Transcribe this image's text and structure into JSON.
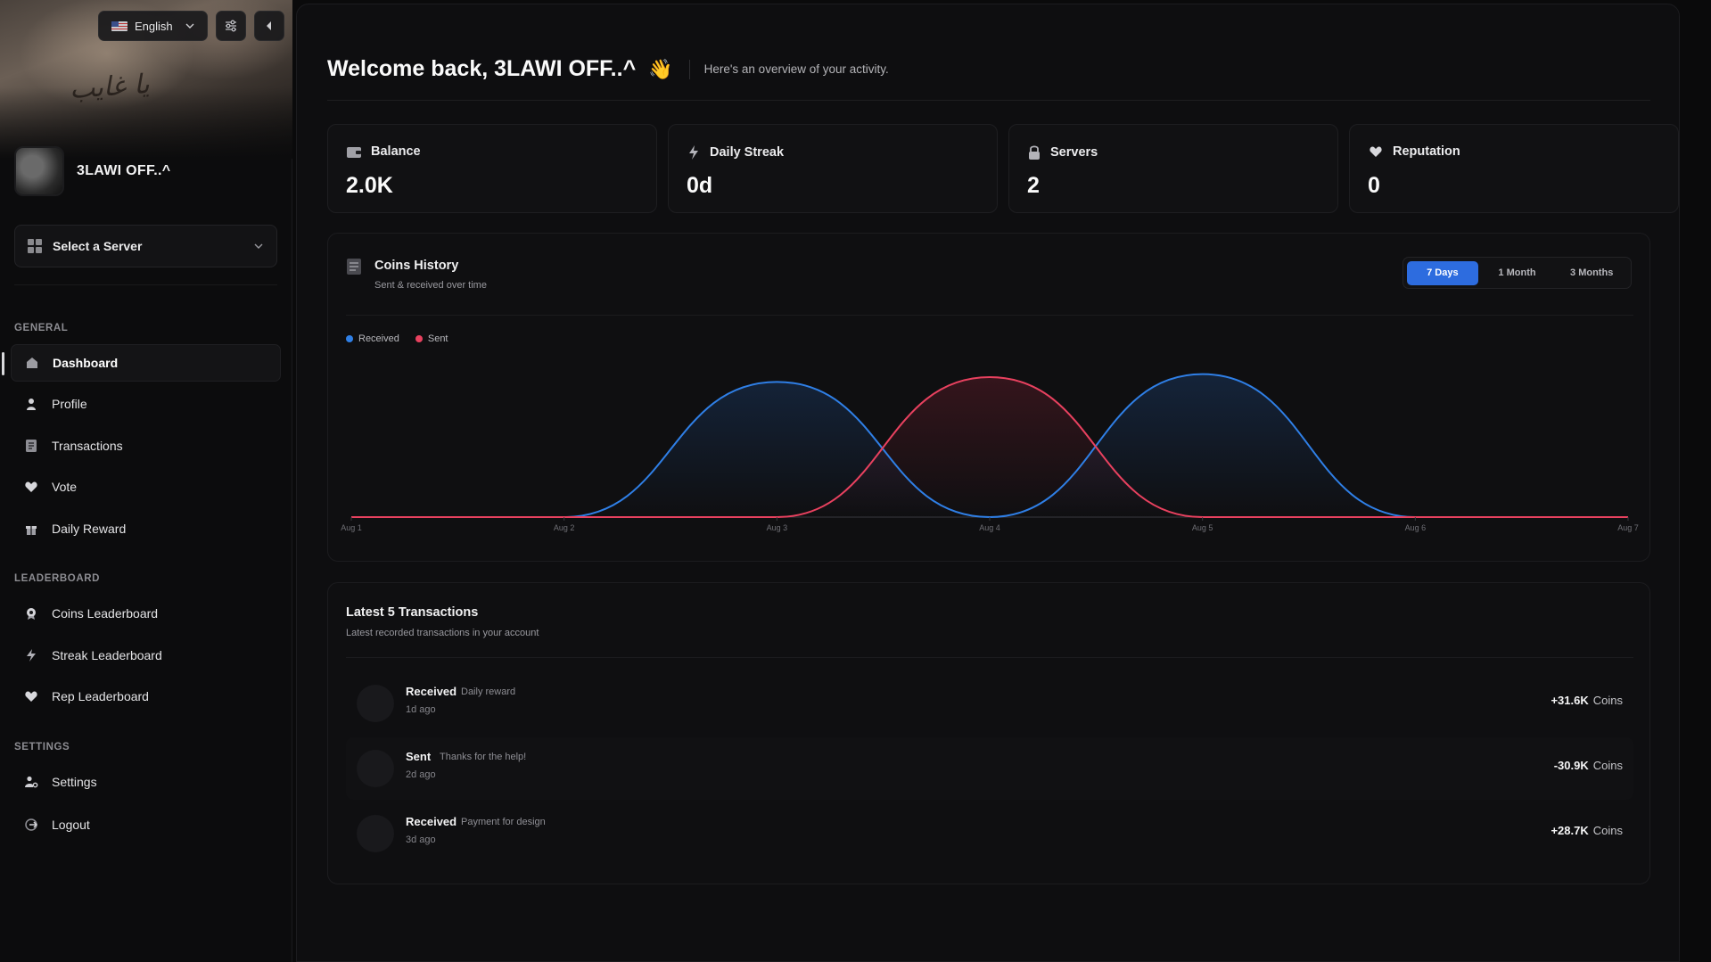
{
  "sidebar": {
    "language": "English",
    "banner_script": "يا غايب",
    "username": "3LAWI OFF..^",
    "server_select": "Select a Server",
    "sections": {
      "general": "GENERAL",
      "leaderboard": "LEADERBOARD",
      "settings": "SETTINGS"
    },
    "nav": {
      "dashboard": "Dashboard",
      "profile": "Profile",
      "transactions": "Transactions",
      "vote": "Vote",
      "daily_reward": "Daily Reward",
      "coins_leaderboard": "Coins Leaderboard",
      "streak_leaderboard": "Streak Leaderboard",
      "rep_leaderboard": "Rep Leaderboard",
      "settings": "Settings",
      "logout": "Logout"
    }
  },
  "header": {
    "welcome": "Welcome back, 3LAWI OFF..^",
    "wave": "👋",
    "subtitle": "Here's an overview of your activity."
  },
  "stats": [
    {
      "label": "Balance",
      "value": "2.0K",
      "icon": "wallet-icon"
    },
    {
      "label": "Daily Streak",
      "value": "0d",
      "icon": "bolt-icon"
    },
    {
      "label": "Servers",
      "value": "2",
      "icon": "server-icon"
    },
    {
      "label": "Reputation",
      "value": "0",
      "icon": "heart-icon"
    }
  ],
  "coins_history": {
    "title": "Coins History",
    "subtitle": "Sent & received over time",
    "ranges": [
      "7 Days",
      "1 Month",
      "3 Months"
    ],
    "active_range": "7 Days"
  },
  "chart_data": {
    "type": "line",
    "x": [
      "Aug 1",
      "Aug 2",
      "Aug 3",
      "Aug 4",
      "Aug 5",
      "Aug 6",
      "Aug 7"
    ],
    "series": [
      {
        "name": "Received",
        "color": "#2f7fe6",
        "values": [
          0,
          0,
          31.6,
          0,
          33.4,
          0,
          0
        ]
      },
      {
        "name": "Sent",
        "color": "#e8415f",
        "values": [
          0,
          0,
          0,
          32.7,
          0,
          0,
          0
        ]
      }
    ],
    "ylim": [
      0,
      35
    ],
    "grid": false,
    "legend": "top-left"
  },
  "transactions": {
    "title": "Latest 5 Transactions",
    "subtitle": "Latest recorded transactions in your account",
    "unit": "Coins",
    "rows": [
      {
        "type": "Received",
        "note": "Daily reward",
        "time": "1d ago",
        "amount": "+31.6K"
      },
      {
        "type": "Sent",
        "note": "Thanks for the help!",
        "time": "2d ago",
        "amount": "-30.9K"
      },
      {
        "type": "Received",
        "note": "Payment for design",
        "time": "3d ago",
        "amount": "+28.7K"
      }
    ]
  }
}
